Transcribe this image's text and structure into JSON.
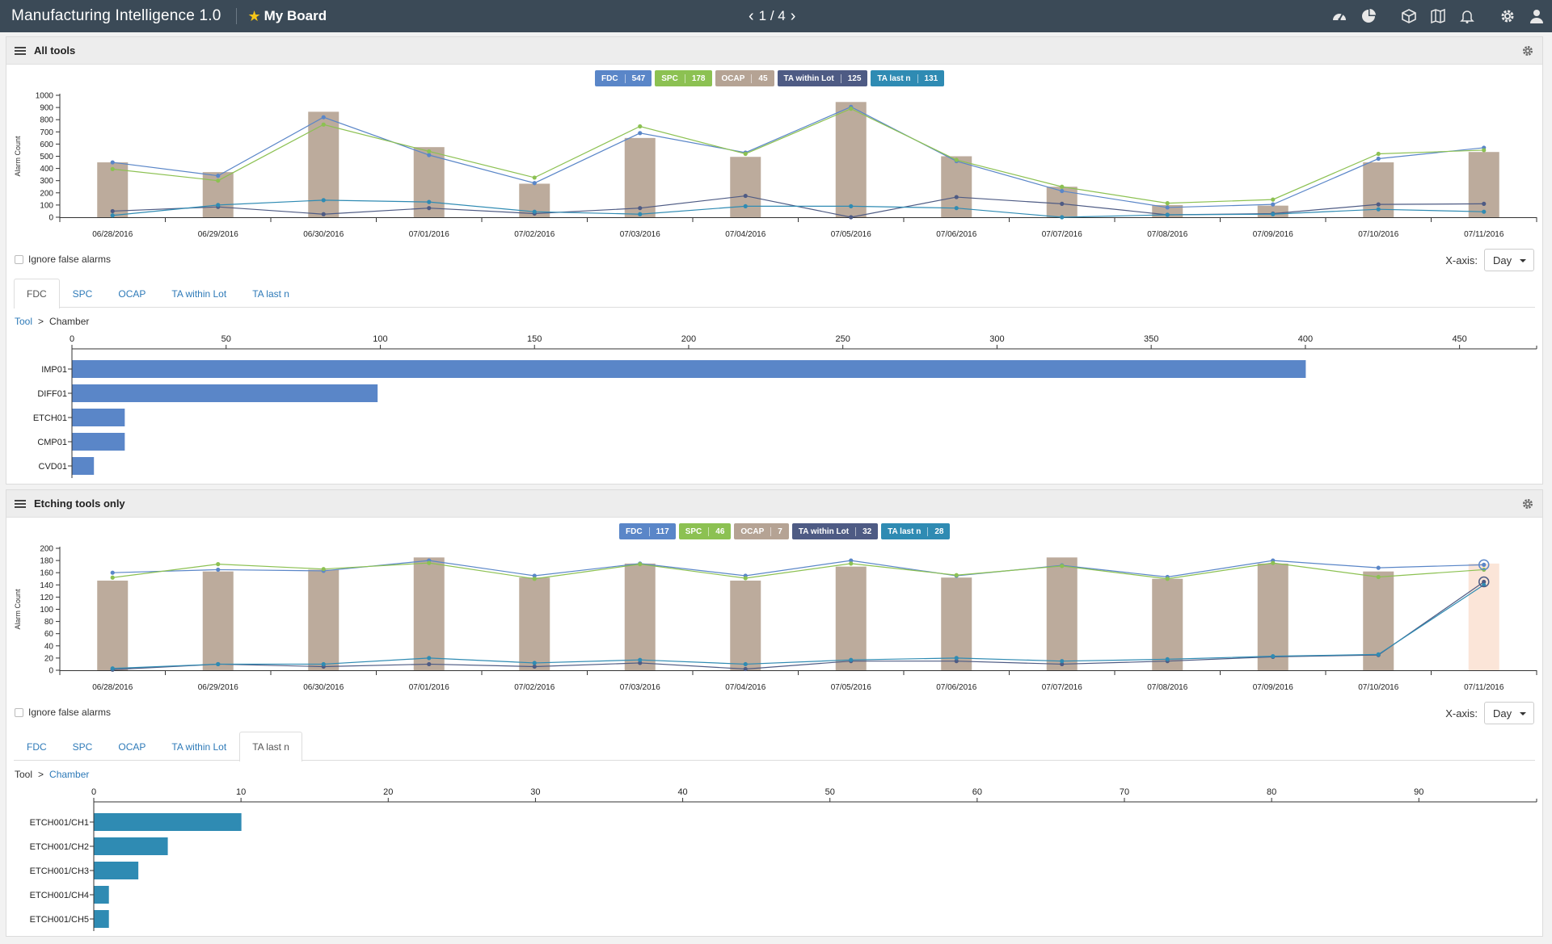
{
  "app": {
    "title": "Manufacturing Intelligence 1.0",
    "board": "My Board",
    "page": "1 / 4"
  },
  "topbar_icons": [
    "dashboard-icon",
    "pie-chart-icon",
    "cube-icon",
    "map-icon",
    "bell-icon",
    "gear-icon",
    "user-icon"
  ],
  "panels": [
    {
      "title": "All tools",
      "legend": [
        {
          "label": "FDC",
          "count": "547",
          "color": "#5a86c8"
        },
        {
          "label": "SPC",
          "count": "178",
          "color": "#8cc152"
        },
        {
          "label": "OCAP",
          "count": "45",
          "color": "#b5a394"
        },
        {
          "label": "TA within Lot",
          "count": "125",
          "color": "#4e5b84"
        },
        {
          "label": "TA last n",
          "count": "131",
          "color": "#2f8bb3"
        }
      ],
      "ignore_label": "Ignore false alarms",
      "xaxis_label": "X-axis:",
      "xaxis_value": "Day",
      "tabs": [
        "FDC",
        "SPC",
        "OCAP",
        "TA within Lot",
        "TA last n"
      ],
      "active_tab": 0,
      "breadcrumb": [
        "Tool",
        ">",
        "Chamber"
      ]
    },
    {
      "title": "Etching tools only",
      "legend": [
        {
          "label": "FDC",
          "count": "117",
          "color": "#5a86c8"
        },
        {
          "label": "SPC",
          "count": "46",
          "color": "#8cc152"
        },
        {
          "label": "OCAP",
          "count": "7",
          "color": "#b5a394"
        },
        {
          "label": "TA within Lot",
          "count": "32",
          "color": "#4e5b84"
        },
        {
          "label": "TA last n",
          "count": "28",
          "color": "#2f8bb3"
        }
      ],
      "ignore_label": "Ignore false alarms",
      "xaxis_label": "X-axis:",
      "xaxis_value": "Day",
      "tabs": [
        "FDC",
        "SPC",
        "OCAP",
        "TA within Lot",
        "TA last n"
      ],
      "active_tab": 4,
      "breadcrumb": [
        "Tool",
        ">",
        "Chamber"
      ]
    }
  ],
  "chart_data": [
    {
      "type": "bar+line",
      "ylabel": "Alarm Count",
      "ylim": [
        0,
        1000
      ],
      "yticks": [
        0,
        100,
        200,
        300,
        400,
        500,
        600,
        700,
        800,
        900,
        1000
      ],
      "categories": [
        "06/28/2016",
        "06/29/2016",
        "06/30/2016",
        "07/01/2016",
        "07/02/2016",
        "07/03/2016",
        "07/04/2016",
        "07/05/2016",
        "07/06/2016",
        "07/07/2016",
        "07/08/2016",
        "07/09/2016",
        "07/10/2016",
        "07/11/2016"
      ],
      "bars": {
        "name": "OCAP",
        "color": "#bcab9c",
        "values": [
          450,
          370,
          865,
          575,
          275,
          650,
          495,
          945,
          500,
          250,
          100,
          95,
          450,
          535
        ]
      },
      "series": [
        {
          "name": "FDC",
          "color": "#5a86c8",
          "values": [
            450,
            340,
            820,
            510,
            280,
            690,
            530,
            905,
            460,
            215,
            80,
            105,
            480,
            570
          ]
        },
        {
          "name": "SPC",
          "color": "#8cc152",
          "values": [
            395,
            300,
            760,
            540,
            325,
            745,
            520,
            890,
            470,
            250,
            115,
            145,
            520,
            550
          ]
        },
        {
          "name": "TA within Lot",
          "color": "#4e5b84",
          "values": [
            50,
            85,
            25,
            75,
            30,
            75,
            175,
            0,
            165,
            110,
            20,
            30,
            105,
            110
          ]
        },
        {
          "name": "TA last n",
          "color": "#2f8bb3",
          "values": [
            15,
            100,
            140,
            125,
            45,
            25,
            90,
            90,
            75,
            0,
            20,
            25,
            65,
            45
          ]
        }
      ]
    },
    {
      "type": "bar",
      "orientation": "horizontal",
      "xlim": [
        0,
        475
      ],
      "xticks": [
        0,
        50,
        100,
        150,
        200,
        250,
        300,
        350,
        400,
        450
      ],
      "color": "#5a86c8",
      "categories": [
        "IMP01",
        "DIFF01",
        "ETCH01",
        "CMP01",
        "CVD01"
      ],
      "values": [
        400,
        99,
        17,
        17,
        7
      ]
    },
    {
      "type": "bar+line",
      "ylabel": "Alarm Count",
      "ylim": [
        0,
        200
      ],
      "yticks": [
        0,
        20,
        40,
        60,
        80,
        100,
        120,
        140,
        160,
        180,
        200
      ],
      "categories": [
        "06/28/2016",
        "06/29/2016",
        "06/30/2016",
        "07/01/2016",
        "07/02/2016",
        "07/03/2016",
        "07/04/2016",
        "07/05/2016",
        "07/06/2016",
        "07/07/2016",
        "07/08/2016",
        "07/09/2016",
        "07/10/2016",
        "07/11/2016"
      ],
      "bars": {
        "name": "OCAP",
        "color": "#bcab9c",
        "highlight_color": "#fbe5d8",
        "highlight_index": 13,
        "values": [
          147,
          162,
          165,
          185,
          152,
          175,
          147,
          170,
          152,
          185,
          150,
          175,
          162,
          175
        ]
      },
      "series": [
        {
          "name": "FDC",
          "color": "#5a86c8",
          "values": [
            160,
            165,
            163,
            180,
            155,
            175,
            155,
            180,
            155,
            172,
            153,
            180,
            168,
            173
          ]
        },
        {
          "name": "SPC",
          "color": "#8cc152",
          "values": [
            152,
            174,
            166,
            176,
            150,
            174,
            151,
            175,
            156,
            171,
            150,
            176,
            153,
            165
          ]
        },
        {
          "name": "TA within Lot",
          "color": "#4e5b84",
          "values": [
            1,
            10,
            6,
            10,
            6,
            12,
            2,
            15,
            15,
            10,
            15,
            22,
            25,
            145
          ]
        },
        {
          "name": "TA last n",
          "color": "#2f8bb3",
          "values": [
            3,
            10,
            10,
            20,
            12,
            17,
            10,
            17,
            20,
            15,
            18,
            23,
            26,
            140
          ]
        }
      ]
    },
    {
      "type": "bar",
      "orientation": "horizontal",
      "xlim": [
        0,
        98
      ],
      "xticks": [
        0,
        10,
        20,
        30,
        40,
        50,
        60,
        70,
        80,
        90
      ],
      "color": "#2f8bb3",
      "categories": [
        "ETCH001/CH1",
        "ETCH001/CH2",
        "ETCH001/CH3",
        "ETCH001/CH4",
        "ETCH001/CH5"
      ],
      "values": [
        10,
        5,
        3,
        1,
        1
      ]
    }
  ]
}
